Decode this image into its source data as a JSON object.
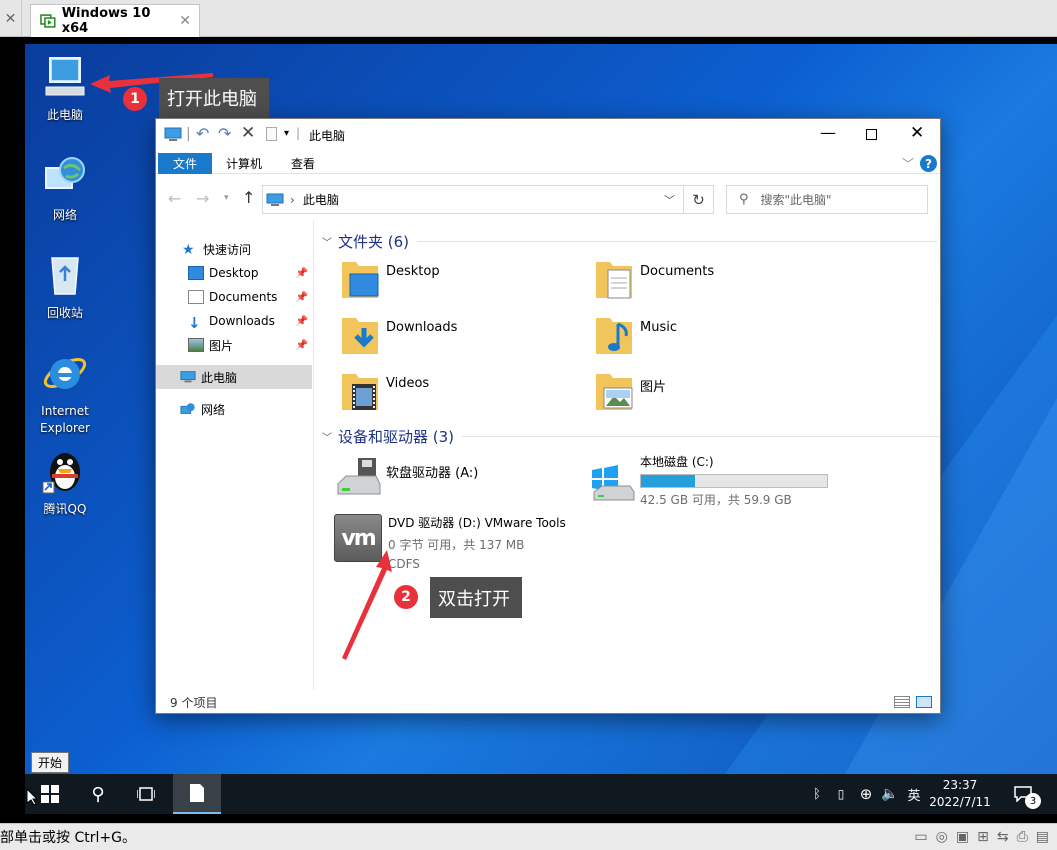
{
  "vm_tab": {
    "title": "Windows 10 x64",
    "close": "✕"
  },
  "desktop_icons": [
    {
      "label": "此电脑"
    },
    {
      "label": "网络"
    },
    {
      "label": "回收站"
    },
    {
      "label": "Internet Explorer"
    },
    {
      "label": "腾讯QQ"
    }
  ],
  "callouts": [
    {
      "number": "1",
      "text": "打开此电脑"
    },
    {
      "number": "2",
      "text": "双击打开"
    }
  ],
  "explorer": {
    "title": "此电脑",
    "ribbon_tabs": [
      "文件",
      "计算机",
      "查看"
    ],
    "help": "?",
    "address": "此电脑",
    "search_placeholder": "搜索\"此电脑\"",
    "nav": {
      "quick_access": "快速访问",
      "items": [
        "Desktop",
        "Documents",
        "Downloads",
        "图片"
      ],
      "this_pc": "此电脑",
      "network": "网络"
    },
    "folders_header": "文件夹 (6)",
    "folders": [
      "Desktop",
      "Documents",
      "Downloads",
      "Music",
      "Videos",
      "图片"
    ],
    "devices_header": "设备和驱动器 (3)",
    "devices": {
      "floppy": {
        "name": "软盘驱动器 (A:)"
      },
      "local_disk": {
        "name": "本地磁盘 (C:)",
        "detail": "42.5 GB 可用，共 59.9 GB",
        "used_fraction": 0.29
      },
      "dvd": {
        "name": "DVD 驱动器 (D:) VMware Tools",
        "detail": "0 字节 可用，共 137 MB",
        "fs": "CDFS",
        "logo": "vm"
      }
    },
    "status": "9 个项目"
  },
  "tooltip": "开始",
  "taskbar": {
    "time": "23:37",
    "date": "2022/7/11",
    "ime": "英",
    "notif_count": "3"
  },
  "bottom_hint": "部单击或按 Ctrl+G。",
  "colors": {
    "accent": "#0078d7",
    "disk_bar": "#26a0da",
    "callout_bg": "#4e4e4e",
    "badge": "#e8313a"
  }
}
